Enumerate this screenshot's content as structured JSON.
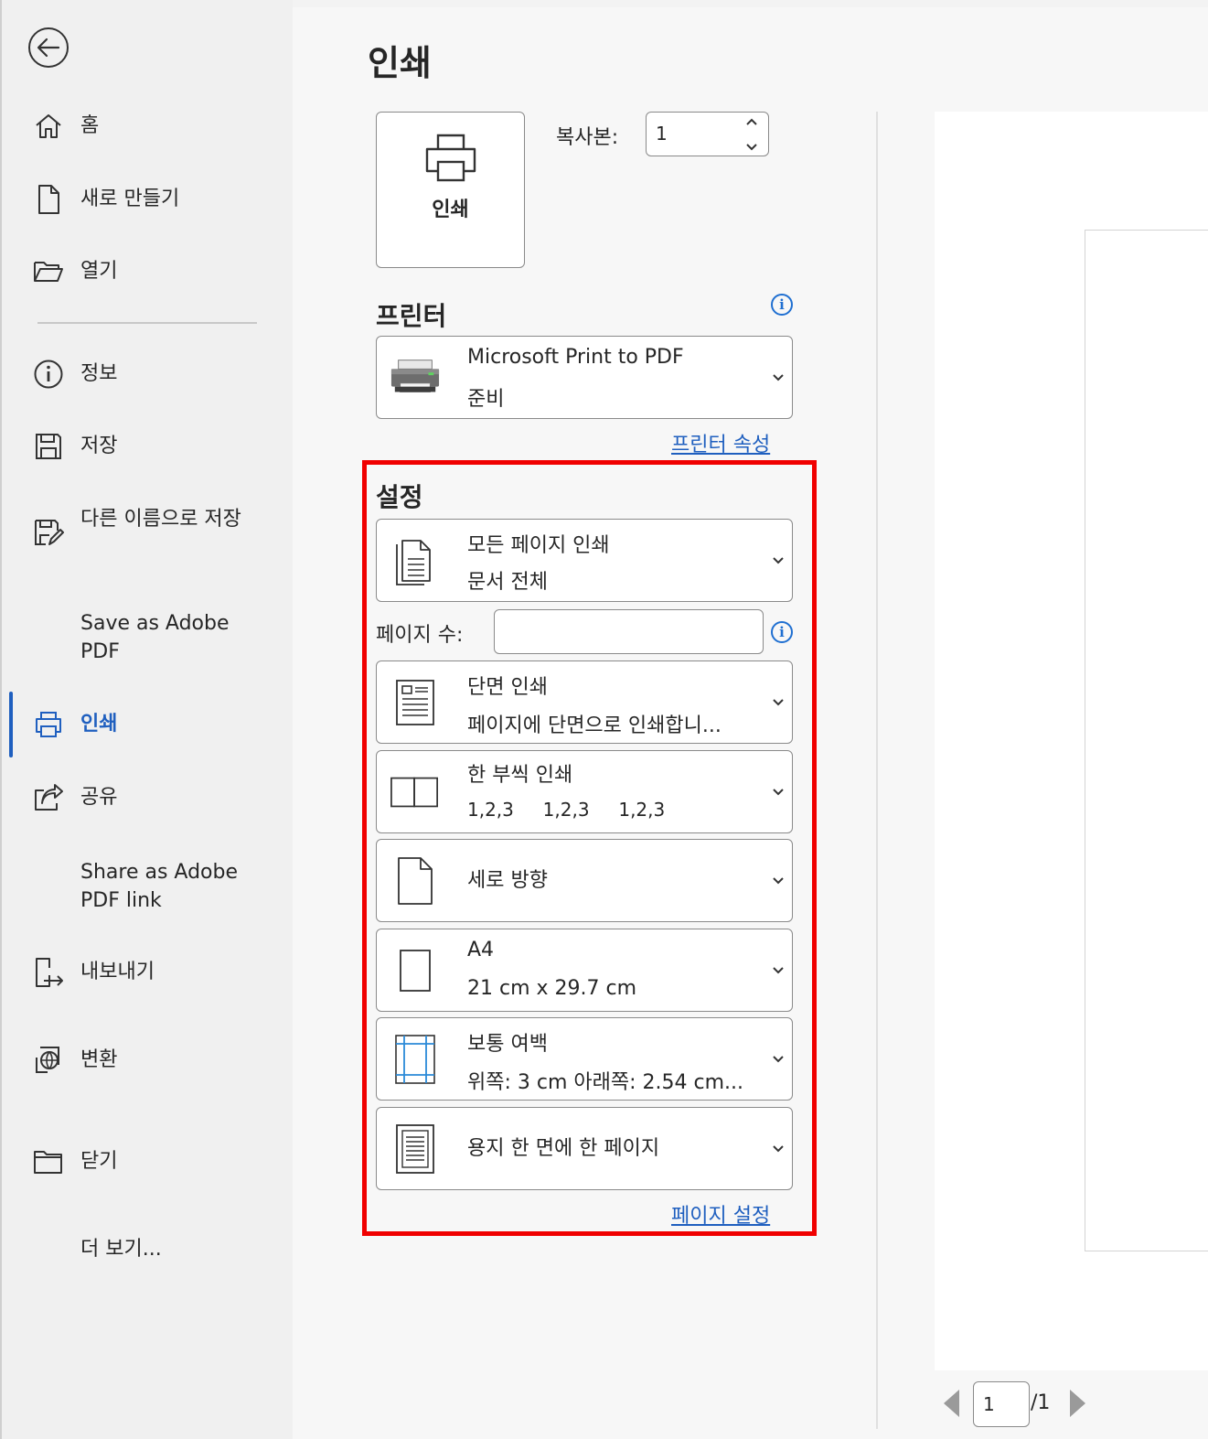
{
  "sidebar": {
    "items": [
      {
        "label": "홈"
      },
      {
        "label": "새로 만들기"
      },
      {
        "label": "열기"
      },
      {
        "label": "정보"
      },
      {
        "label": "저장"
      },
      {
        "label": "다른 이름으로 저장"
      },
      {
        "label": "Save as Adobe PDF"
      },
      {
        "label": "인쇄"
      },
      {
        "label": "공유"
      },
      {
        "label": "Share as Adobe PDF link"
      },
      {
        "label": "내보내기"
      },
      {
        "label": "변환"
      },
      {
        "label": "닫기"
      },
      {
        "label": "더 보기..."
      }
    ],
    "active": "인쇄"
  },
  "main": {
    "title": "인쇄",
    "print_button": "인쇄",
    "copies_label": "복사본:",
    "copies_value": "1",
    "printer": {
      "heading": "프린터",
      "name": "Microsoft Print to PDF",
      "status": "준비",
      "properties_link": "프린터 속성"
    },
    "settings": {
      "heading": "설정",
      "range": {
        "title": "모든 페이지 인쇄",
        "sub": "문서 전체"
      },
      "pages_label": "페이지 수:",
      "pages_value": "",
      "sides": {
        "title": "단면 인쇄",
        "sub": "페이지에 단면으로 인쇄합니..."
      },
      "collate": {
        "title": "한 부씩 인쇄",
        "sub": "1,2,3     1,2,3     1,2,3"
      },
      "orientation": {
        "title": "세로 방향"
      },
      "paper": {
        "title": "A4",
        "sub": "21 cm x 29.7 cm"
      },
      "margins": {
        "title": "보통 여백",
        "sub": "위쪽: 3 cm 아래쪽: 2.54 cm..."
      },
      "per_sheet": {
        "title": "용지 한 면에 한 페이지"
      },
      "page_setup_link": "페이지 설정"
    }
  },
  "preview": {
    "page_current": "1",
    "page_total": "/1"
  },
  "colors": {
    "accent": "#1f5fbf",
    "highlight": "#f00000"
  }
}
